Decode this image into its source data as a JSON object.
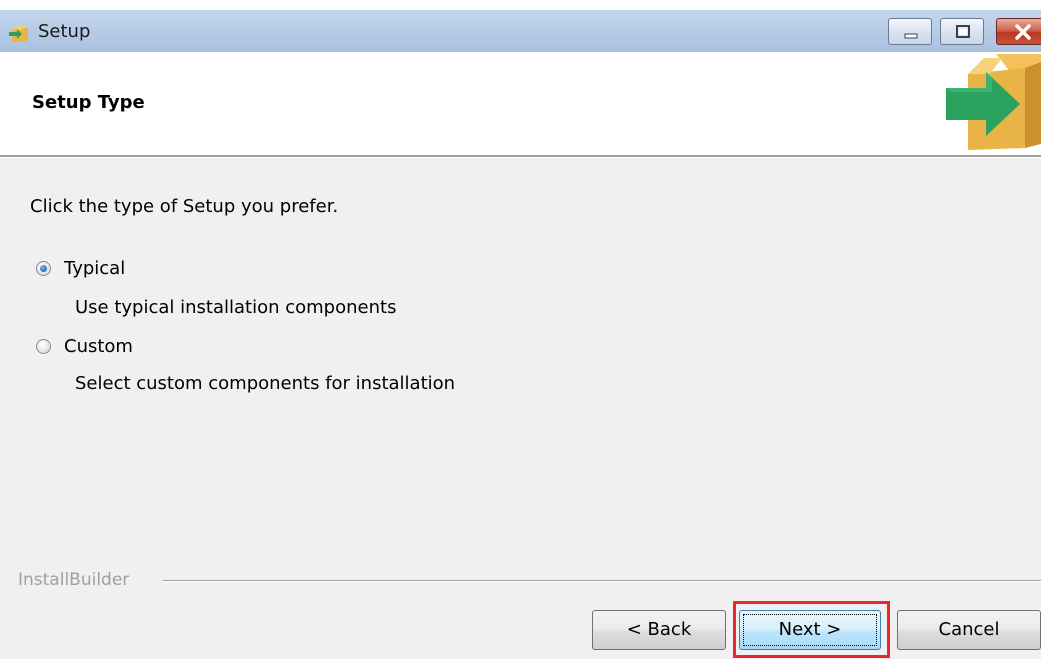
{
  "window": {
    "title": "Setup",
    "controls": [
      "minimize",
      "maximize",
      "close"
    ]
  },
  "header": {
    "title": "Setup Type"
  },
  "body": {
    "instruction": "Click the type of Setup you prefer.",
    "options": [
      {
        "label": "Typical",
        "description": "Use typical installation components",
        "selected": true
      },
      {
        "label": "Custom",
        "description": "Select custom components for installation",
        "selected": false
      }
    ]
  },
  "footer": {
    "brand": "InstallBuilder",
    "buttons": {
      "back": "< Back",
      "next": "Next >",
      "cancel": "Cancel"
    },
    "highlighted_button": "next"
  },
  "colors": {
    "title_bar": "#b6cbe6",
    "highlight": "#e8282d",
    "radio_selected": "#2a6bc2",
    "brand_text": "#a0a0a0"
  },
  "icons": {
    "app": "installer-box-arrow-icon",
    "logo": "box-with-green-arrow-logo"
  }
}
